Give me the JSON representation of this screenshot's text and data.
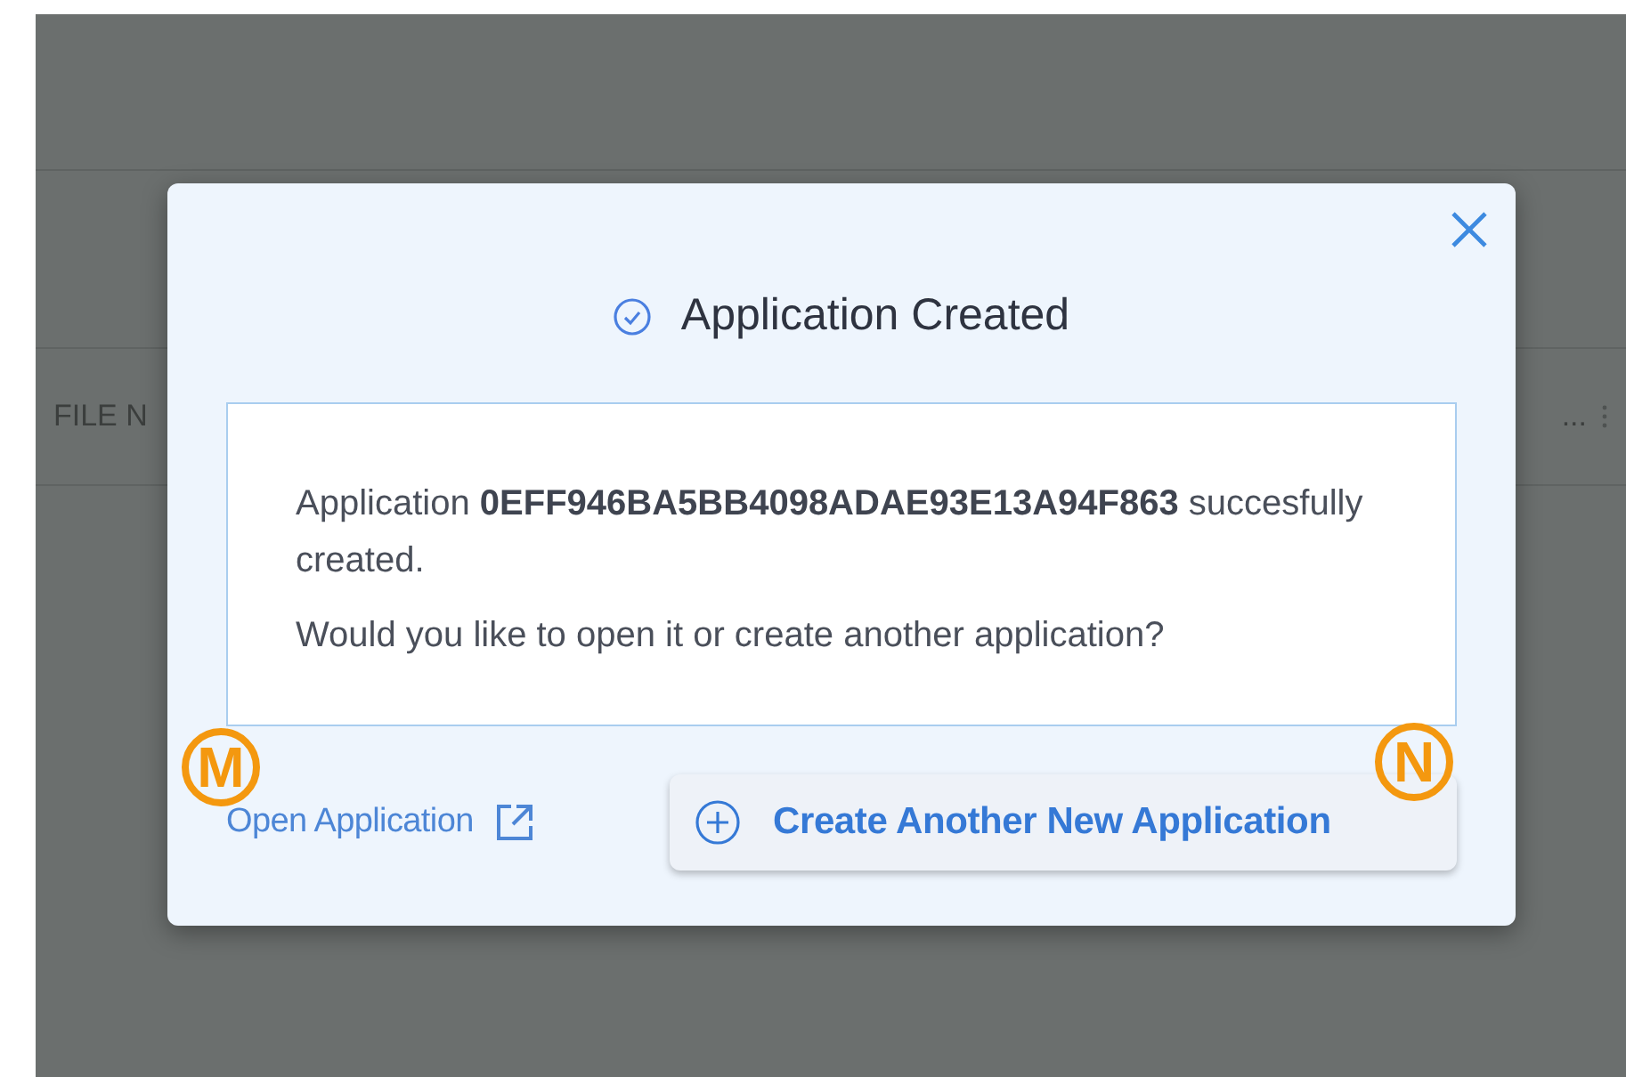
{
  "background_table": {
    "column_1": "FILE N",
    "column_last": "..."
  },
  "dialog": {
    "title": "Application Created",
    "message": "Application **0EFF946BA5BB4098ADAE93E13A94F863** succesfully created.",
    "question": "Would you like to open it or create another application?",
    "link": "Open Application",
    "button": "Create Another New Application"
  },
  "markers": [
    {
      "label": "M"
    },
    {
      "label": "N"
    }
  ]
}
